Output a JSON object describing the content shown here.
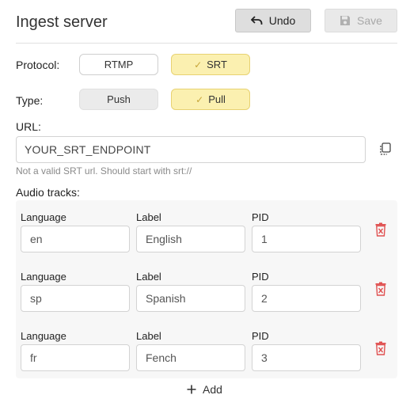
{
  "header": {
    "title": "Ingest server",
    "undo_label": "Undo",
    "save_label": "Save"
  },
  "protocol": {
    "label": "Protocol:",
    "options": [
      "RTMP",
      "SRT"
    ],
    "selected": "SRT"
  },
  "type": {
    "label": "Type:",
    "options": [
      "Push",
      "Pull"
    ],
    "selected": "Pull"
  },
  "url": {
    "label": "URL:",
    "value": "YOUR_SRT_ENDPOINT",
    "hint": "Not a valid SRT url. Should start with srt://"
  },
  "audio_tracks": {
    "label": "Audio tracks:",
    "column_labels": {
      "language": "Language",
      "label": "Label",
      "pid": "PID"
    },
    "tracks": [
      {
        "language": "en",
        "label": "English",
        "pid": "1"
      },
      {
        "language": "sp",
        "label": "Spanish",
        "pid": "2"
      },
      {
        "language": "fr",
        "label": "Fench",
        "pid": "3"
      }
    ],
    "add_label": "Add"
  },
  "colors": {
    "active_pill": "#fbf0b0",
    "active_border": "#e8d272",
    "trash": "#e05050",
    "panel": "#f7f7f7"
  }
}
